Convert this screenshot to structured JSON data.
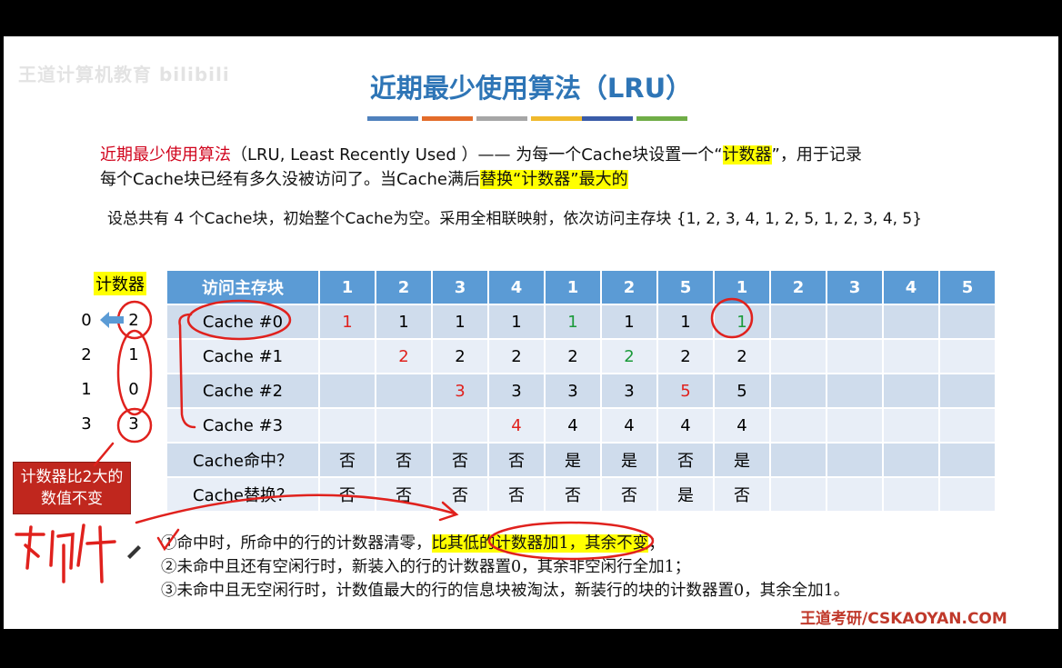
{
  "watermark": "王道计算机教育 bilibili",
  "title": "近期最少使用算法（LRU）",
  "color_bar": [
    "#4f81bd",
    "#e36c2a",
    "#a6a6a6",
    "#f0b92c",
    "#3a5ca8",
    "#70ad47"
  ],
  "definition": {
    "term": "近期最少使用算法",
    "abbr_open": "（LRU, Least Recently Used ）",
    "dash": "—— 为每一个Cache块设置一个“",
    "counter_word": "计数器",
    "after_counter": "”，用于记录",
    "line2": "每个Cache块已经有多久没被访问了。当Cache满后",
    "line2_hl": "替换“计数器”最大的"
  },
  "scenario": "设总共有 4 个Cache块，初始整个Cache为空。采用全相联映射，依次访问主存块 {1, 2, 3, 4, 1, 2, 5, 1, 2, 3, 4, 5}",
  "counter_label": "计数器",
  "counters": [
    {
      "old": "0",
      "cur": "2"
    },
    {
      "old": "2",
      "cur": "1"
    },
    {
      "old": "1",
      "cur": "0"
    },
    {
      "old": "3",
      "cur": "3"
    }
  ],
  "table": {
    "header_label": "访问主存块",
    "sequence": [
      "1",
      "2",
      "3",
      "4",
      "1",
      "2",
      "5",
      "1",
      "2",
      "3",
      "4",
      "5"
    ],
    "rows": [
      {
        "label": "Cache #0",
        "cells": [
          "1",
          "1",
          "1",
          "1",
          "1",
          "1",
          "1",
          "1",
          "",
          "",
          "",
          ""
        ]
      },
      {
        "label": "Cache #1",
        "cells": [
          "",
          "2",
          "2",
          "2",
          "2",
          "2",
          "2",
          "2",
          "",
          "",
          "",
          ""
        ]
      },
      {
        "label": "Cache #2",
        "cells": [
          "",
          "",
          "3",
          "3",
          "3",
          "3",
          "5",
          "5",
          "",
          "",
          "",
          ""
        ]
      },
      {
        "label": "Cache #3",
        "cells": [
          "",
          "",
          "",
          "4",
          "4",
          "4",
          "4",
          "4",
          "",
          "",
          "",
          ""
        ]
      },
      {
        "label": "Cache命中？",
        "cells": [
          "否",
          "否",
          "否",
          "否",
          "是",
          "是",
          "否",
          "是",
          "",
          "",
          "",
          ""
        ]
      },
      {
        "label": "Cache替换？",
        "cells": [
          "否",
          "否",
          "否",
          "否",
          "否",
          "否",
          "是",
          "否",
          "",
          "",
          "",
          ""
        ]
      }
    ],
    "highlight_red": [
      [
        0,
        0
      ],
      [
        1,
        1
      ],
      [
        2,
        2
      ],
      [
        3,
        3
      ],
      [
        2,
        6
      ]
    ],
    "highlight_green": [
      [
        0,
        4
      ],
      [
        1,
        5
      ],
      [
        0,
        7
      ]
    ]
  },
  "callout": "计数器比2大的数值不变",
  "handwriting": "不变",
  "rules": {
    "r1_a": "①命中时，所命中的行的计数器清零，",
    "r1_hl": "比其低的计数器加1，其余不变",
    "r1_end": "；",
    "r2": "②未命中且还有空闲行时，新装入的行的计数器置0，其余非空闲行全加1；",
    "r3": "③未命中且无空闲行时，计数值最大的行的信息块被淘汰，新装行的块的计数器置0，其余全加1。"
  },
  "footer": "王道考研/CSKAOYAN.COM"
}
